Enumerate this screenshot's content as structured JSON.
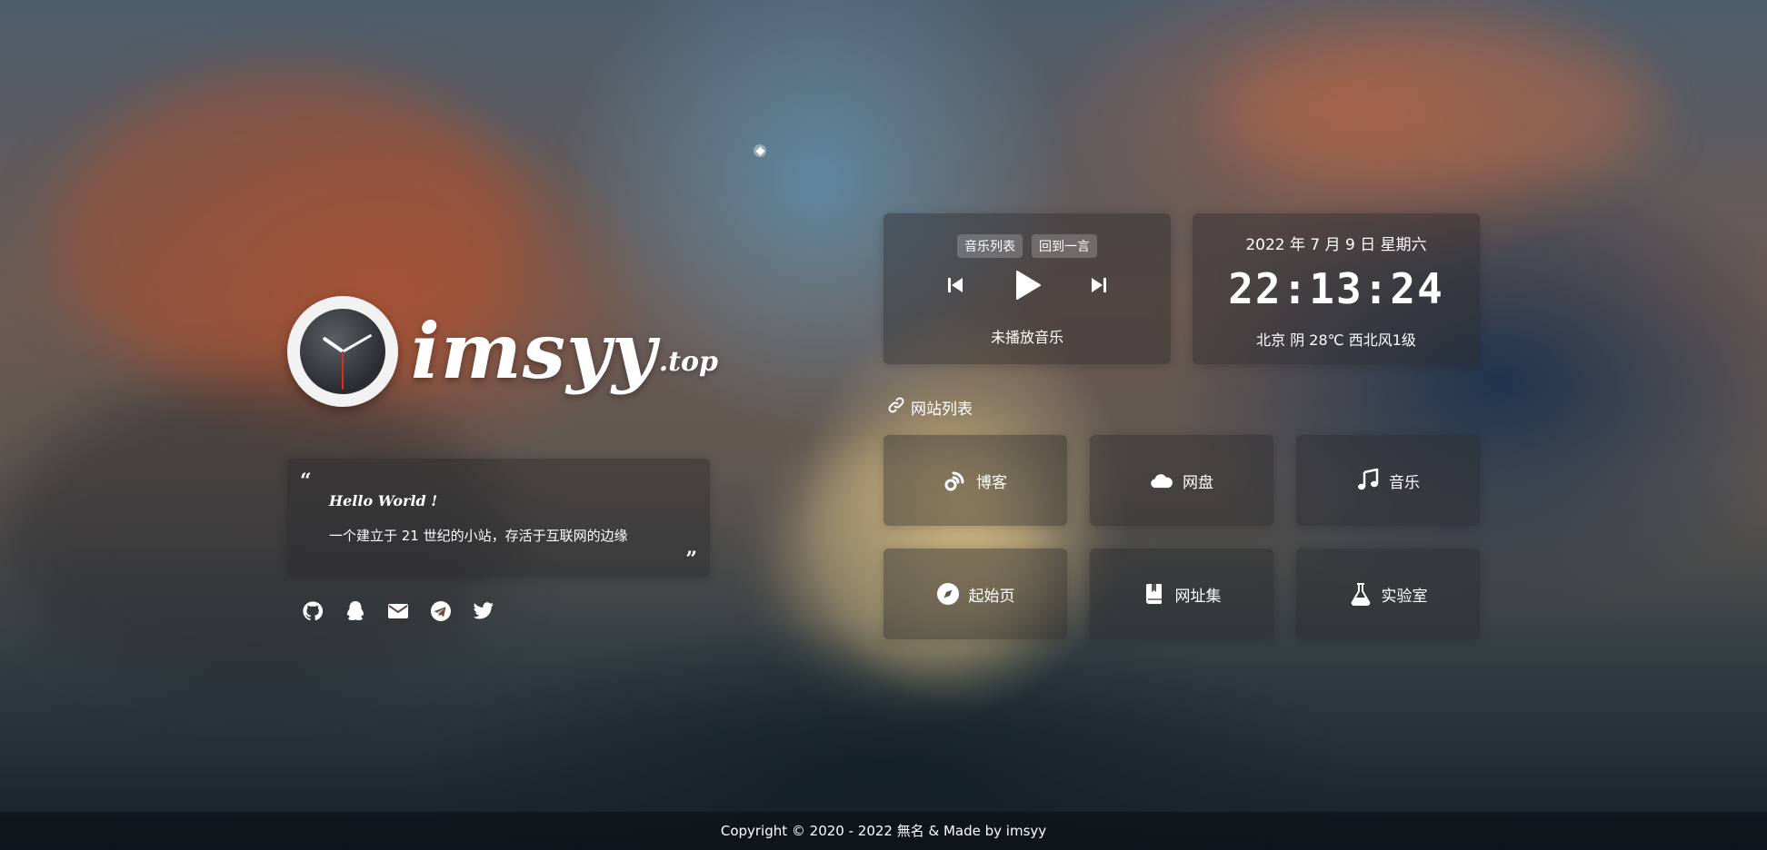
{
  "brand": {
    "name": "imsyy",
    "suffix": ".top"
  },
  "quote": {
    "open_mark": "“",
    "close_mark": "”",
    "title": "Hello World !",
    "text": "一个建立于 21 世纪的小站，存活于互联网的边缘"
  },
  "social": [
    {
      "name": "github",
      "icon": "github-icon"
    },
    {
      "name": "qq",
      "icon": "qq-icon"
    },
    {
      "name": "email",
      "icon": "mail-icon"
    },
    {
      "name": "telegram",
      "icon": "telegram-icon"
    },
    {
      "name": "twitter",
      "icon": "twitter-icon"
    }
  ],
  "music": {
    "tags": [
      "音乐列表",
      "回到一言"
    ],
    "status": "未播放音乐",
    "controls": [
      "previous-icon",
      "play-icon",
      "next-icon"
    ]
  },
  "clock": {
    "date": "2022 年 7 月 9 日 星期六",
    "time": "22:13:24",
    "weather": "北京 阴 28℃ 西北风1级"
  },
  "sites": {
    "title": "网站列表",
    "title_icon": "link-icon",
    "items": [
      {
        "label": "博客",
        "icon": "blog-icon"
      },
      {
        "label": "网盘",
        "icon": "cloud-icon"
      },
      {
        "label": "音乐",
        "icon": "music-note-icon"
      },
      {
        "label": "起始页",
        "icon": "compass-icon"
      },
      {
        "label": "网址集",
        "icon": "bookmark-book-icon"
      },
      {
        "label": "实验室",
        "icon": "flask-icon"
      }
    ]
  },
  "footer": {
    "text": "Copyright © 2020 - 2022 無名 &  Made by imsyy"
  }
}
